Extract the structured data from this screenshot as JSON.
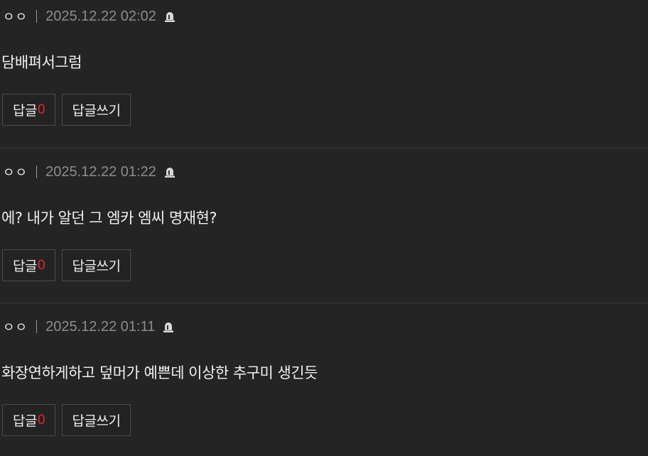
{
  "comments": [
    {
      "author": "ㅇㅇ",
      "date": "2025.12.22 02:02",
      "text": "담배펴서그럼",
      "reply_label": "답글",
      "reply_count": "0",
      "write_label": "답글쓰기"
    },
    {
      "author": "ㅇㅇ",
      "date": "2025.12.22 01:22",
      "text": "에? 내가 알던 그 엠카 엠씨 명재현?",
      "reply_label": "답글",
      "reply_count": "0",
      "write_label": "답글쓰기"
    },
    {
      "author": "ㅇㅇ",
      "date": "2025.12.22 01:11",
      "text": "화장연하게하고 덮머가 예쁜데 이상한 추구미 생긴듯",
      "reply_label": "답글",
      "reply_count": "0",
      "write_label": "답글쓰기"
    }
  ],
  "icons": {
    "report": "siren-icon"
  },
  "colors": {
    "background": "#242424",
    "reply_count": "#e0262a",
    "date": "#8c8c8c"
  }
}
